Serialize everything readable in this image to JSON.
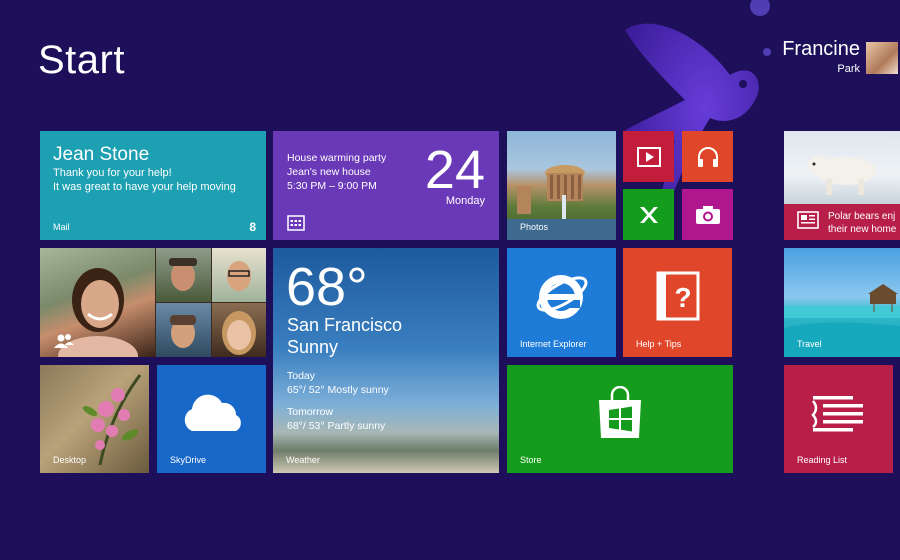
{
  "screen": {
    "title": "Start"
  },
  "user": {
    "first_name": "Francine",
    "last_name": "Park"
  },
  "tiles": {
    "mail": {
      "sender": "Jean Stone",
      "line1": "Thank you for your help!",
      "line2": "It was great to have your help moving",
      "label": "Mail",
      "count": "8"
    },
    "calendar": {
      "event_title": "House warming party",
      "event_location": "Jean's new house",
      "event_time": "5:30 PM – 9:00 PM",
      "day": "24",
      "weekday": "Monday"
    },
    "photos": {
      "label": "Photos"
    },
    "video": {
      "icon": "video-icon"
    },
    "music": {
      "icon": "headphones-icon"
    },
    "games": {
      "icon": "xbox-icon"
    },
    "camera": {
      "icon": "camera-icon"
    },
    "news": {
      "line1": "Polar bears enj",
      "line2": "their new home"
    },
    "people": {},
    "weather": {
      "temp": "68°",
      "city": "San Francisco",
      "condition": "Sunny",
      "today_label": "Today",
      "today_forecast": "65°/ 52° Mostly sunny",
      "tomorrow_label": "Tomorrow",
      "tomorrow_forecast": "68°/ 53° Partly sunny",
      "label": "Weather"
    },
    "ie": {
      "label": "Internet Explorer"
    },
    "help": {
      "label": "Help + Tips"
    },
    "travel": {
      "label": "Travel"
    },
    "desktop": {
      "label": "Desktop"
    },
    "skydrive": {
      "label": "SkyDrive"
    },
    "store": {
      "label": "Store"
    },
    "reading": {
      "label": "Reading List"
    }
  },
  "colors": {
    "background": "#1e0f5a",
    "mail": "#1ca0b2",
    "calendar": "#6a39b8",
    "red": "#c21e3b",
    "orange": "#e0472a",
    "green": "#149c1c",
    "magenta": "#b0178e",
    "blue": "#1e7bd8"
  }
}
